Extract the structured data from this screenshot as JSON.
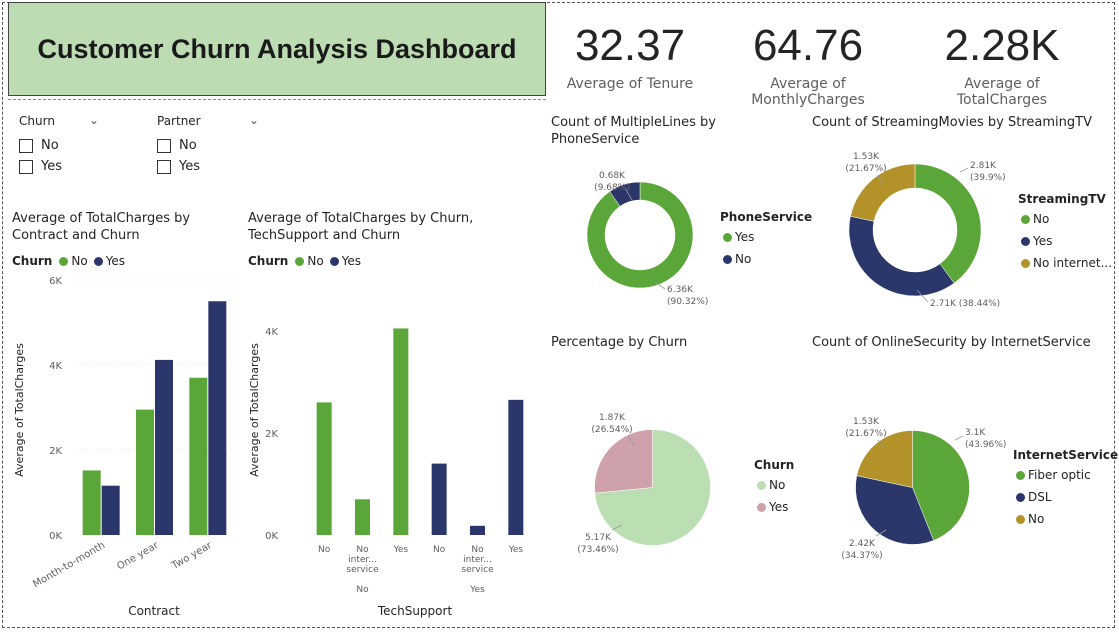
{
  "title": "Customer Churn Analysis Dashboard",
  "kpis": [
    {
      "value": "32.37",
      "label": "Average of Tenure"
    },
    {
      "value": "64.76",
      "label": "Average of MonthlyCharges"
    },
    {
      "value": "2.28K",
      "label": "Average of TotalCharges"
    }
  ],
  "slicers": [
    {
      "title": "Churn",
      "options": [
        "No",
        "Yes"
      ]
    },
    {
      "title": "Partner",
      "options": [
        "No",
        "Yes"
      ]
    }
  ],
  "colors": {
    "green": "#5aa638",
    "navy": "#2b376a",
    "gold": "#b3922a",
    "lightgreen": "#bcdeb3",
    "rose": "#cfa1aa"
  },
  "chart_data": [
    {
      "type": "bar",
      "title_line1": "Average of TotalCharges by",
      "title_line2": "Contract and Churn",
      "legend_title": "Churn",
      "categories": [
        "Month-to-month",
        "One year",
        "Two year"
      ],
      "series": [
        {
          "name": "No",
          "values": [
            1520,
            2950,
            3700
          ]
        },
        {
          "name": "Yes",
          "values": [
            1160,
            4120,
            5500
          ]
        }
      ],
      "ylim": [
        0,
        6000
      ],
      "yticks": [
        "0K",
        "2K",
        "4K",
        "6K"
      ],
      "xlabel": "Contract",
      "ylabel": "Average of TotalCharges"
    },
    {
      "type": "bar",
      "title_line1": "Average of TotalCharges by Churn,",
      "title_line2": "TechSupport and Churn",
      "legend_title": "Churn",
      "legend": [
        "No",
        "Yes"
      ],
      "groups": [
        {
          "label": "No",
          "cats": [
            {
              "label": [
                "No"
              ],
              "value": 2600,
              "series": "No"
            },
            {
              "label": [
                "No",
                "inter...",
                "service"
              ],
              "value": 700,
              "series": "No"
            },
            {
              "label": [
                "Yes"
              ],
              "value": 4050,
              "series": "No"
            }
          ]
        },
        {
          "label": "Yes",
          "cats": [
            {
              "label": [
                "No"
              ],
              "value": 1400,
              "series": "Yes"
            },
            {
              "label": [
                "No",
                "inter...",
                "service"
              ],
              "value": 180,
              "series": "Yes"
            },
            {
              "label": [
                "Yes"
              ],
              "value": 2650,
              "series": "Yes"
            }
          ]
        }
      ],
      "ylim": [
        0,
        5000
      ],
      "yticks": [
        "0K",
        "2K",
        "4K"
      ],
      "xlabel": "TechSupport",
      "ylabel": "Average of TotalCharges"
    },
    {
      "type": "donut",
      "title_line1": "Count of MultipleLines by",
      "title_line2": "PhoneService",
      "legend_title": "PhoneService",
      "slices": [
        {
          "name": "Yes",
          "value": 90.32,
          "label1": "6.36K",
          "label2": "(90.32%)",
          "color": "#5aa638"
        },
        {
          "name": "No",
          "value": 9.68,
          "label1": "0.68K",
          "label2": "(9.68%)",
          "color": "#2b376a"
        }
      ]
    },
    {
      "type": "donut",
      "title_line1": "Count of StreamingMovies by StreamingTV",
      "legend_title": "StreamingTV",
      "slices": [
        {
          "name": "No",
          "value": 39.9,
          "label1": "2.81K",
          "label2": "(39.9%)",
          "color": "#5aa638"
        },
        {
          "name": "Yes",
          "value": 38.44,
          "label1": "2.71K (38.44%)",
          "label2": "",
          "color": "#2b376a"
        },
        {
          "name": "No internet...",
          "value": 21.67,
          "label1": "1.53K",
          "label2": "(21.67%)",
          "color": "#b3922a"
        }
      ]
    },
    {
      "type": "pie",
      "title_line1": "Percentage by Churn",
      "legend_title": "Churn",
      "slices": [
        {
          "name": "No",
          "value": 73.46,
          "label1": "5.17K",
          "label2": "(73.46%)",
          "color": "#bcdeb3"
        },
        {
          "name": "Yes",
          "value": 26.54,
          "label1": "1.87K",
          "label2": "(26.54%)",
          "color": "#cfa1aa"
        }
      ]
    },
    {
      "type": "pie",
      "title_line1": "Count of OnlineSecurity by InternetService",
      "legend_title": "InternetService",
      "slices": [
        {
          "name": "Fiber optic",
          "value": 43.96,
          "label1": "3.1K",
          "label2": "(43.96%)",
          "color": "#5aa638"
        },
        {
          "name": "DSL",
          "value": 34.37,
          "label1": "2.42K",
          "label2": "(34.37%)",
          "color": "#2b376a"
        },
        {
          "name": "No",
          "value": 21.67,
          "label1": "1.53K",
          "label2": "(21.67%)",
          "color": "#b3922a"
        }
      ]
    }
  ]
}
